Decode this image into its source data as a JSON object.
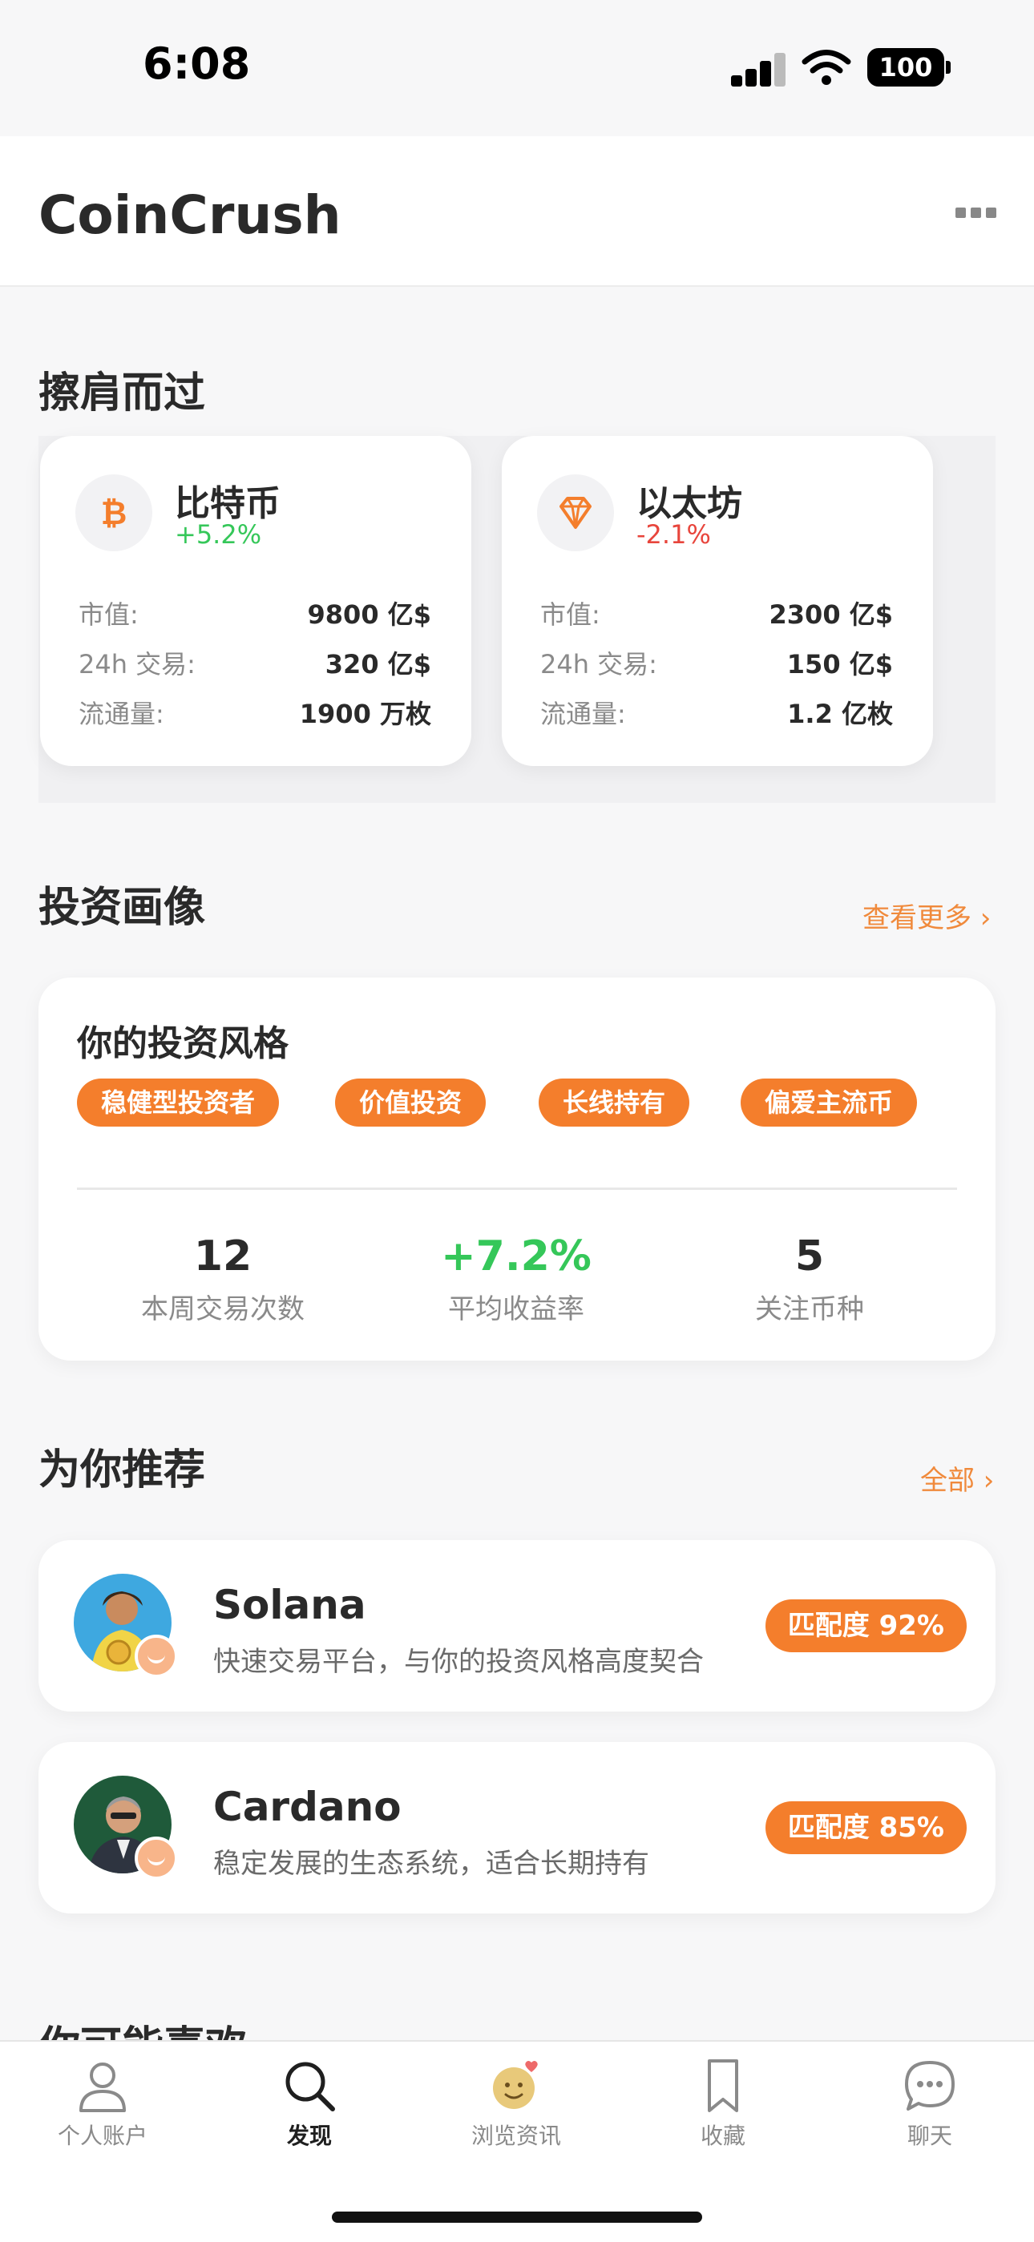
{
  "status_bar": {
    "time": "6:08",
    "battery": "100"
  },
  "header": {
    "app_title": "CoinCrush"
  },
  "section_passing": {
    "title": "擦肩而过"
  },
  "coins": [
    {
      "name": "比特币",
      "change": "+5.2%",
      "change_color": "#35c759",
      "icon": "bitcoin-icon",
      "rows": [
        {
          "label": "市值:",
          "value": "9800 亿$"
        },
        {
          "label": "24h 交易:",
          "value": "320 亿$"
        },
        {
          "label": "流通量:",
          "value": "1900 万枚"
        }
      ]
    },
    {
      "name": "以太坊",
      "change": "-2.1%",
      "change_color": "#e8453c",
      "icon": "diamond-icon",
      "rows": [
        {
          "label": "市值:",
          "value": "2300 亿$"
        },
        {
          "label": "24h 交易:",
          "value": "150 亿$"
        },
        {
          "label": "流通量:",
          "value": "1.2 亿枚"
        }
      ]
    }
  ],
  "section_profile": {
    "title": "投资画像",
    "link": "查看更多 ›"
  },
  "profile": {
    "heading": "你的投资风格",
    "tags": [
      "稳健型投资者",
      "价值投资",
      "长线持有",
      "偏爱主流币"
    ],
    "stats": [
      {
        "value": "12",
        "label": "本周交易次数"
      },
      {
        "value": "+7.2%",
        "label": "平均收益率"
      },
      {
        "value": "5",
        "label": "关注币种"
      }
    ]
  },
  "section_recommend": {
    "title": "为你推荐",
    "link": "全部 ›"
  },
  "recommendations": [
    {
      "name": "Solana",
      "desc": "快速交易平台，与你的投资风格高度契合",
      "match": "匹配度 92%"
    },
    {
      "name": "Cardano",
      "desc": "稳定发展的生态系统，适合长期持有",
      "match": "匹配度 85%"
    }
  ],
  "section_maybe": {
    "title": "你可能喜欢"
  },
  "tabs": [
    {
      "label": "个人账户",
      "icon": "person-icon"
    },
    {
      "label": "发现",
      "icon": "search-icon",
      "active": true
    },
    {
      "label": "浏览资讯",
      "icon": "emoji-icon"
    },
    {
      "label": "收藏",
      "icon": "bookmark-icon"
    },
    {
      "label": "聊天",
      "icon": "chat-icon"
    }
  ],
  "colors": {
    "accent": "#f47e2c",
    "positive": "#35c759",
    "negative": "#e8453c"
  }
}
